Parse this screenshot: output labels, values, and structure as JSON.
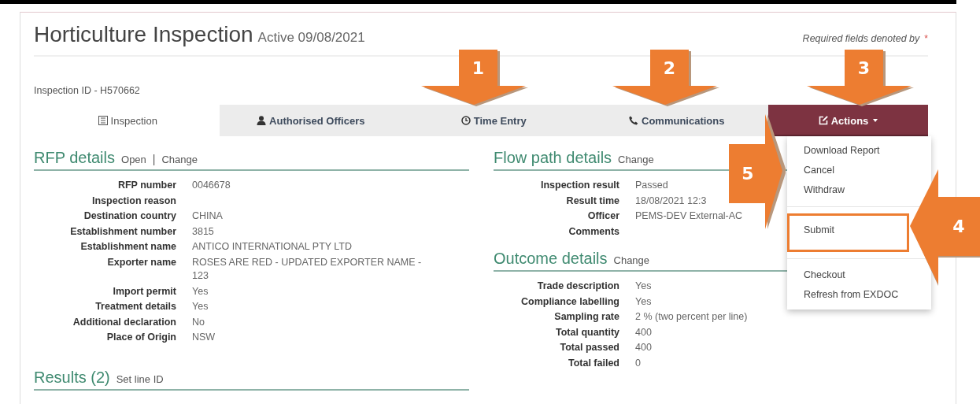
{
  "header": {
    "title": "Horticulture Inspection",
    "status": "Active 09/08/2021",
    "required_note": "Required fields denoted by",
    "required_mark": "*"
  },
  "inspection_id": "Inspection ID - H570662",
  "tabs": [
    {
      "label": "Inspection",
      "selected": true,
      "kind": "tab"
    },
    {
      "label": "Authorised Officers",
      "selected": false,
      "kind": "tab"
    },
    {
      "label": "Time Entry",
      "selected": false,
      "kind": "tab"
    },
    {
      "label": "Communications",
      "selected": false,
      "kind": "tab"
    },
    {
      "label": "Actions",
      "selected": false,
      "kind": "dropdown",
      "expanded": true
    }
  ],
  "rfp_details": {
    "title": "RFP details",
    "links": [
      "Open",
      "Change"
    ],
    "separator": "|",
    "rows": [
      {
        "label": "RFP number",
        "value": "0046678"
      },
      {
        "label": "Inspection reason",
        "value": ""
      },
      {
        "label": "Destination country",
        "value": "CHINA"
      },
      {
        "label": "Establishment number",
        "value": "3815"
      },
      {
        "label": "Establishment name",
        "value": "ANTICO INTERNATIONAL PTY LTD"
      },
      {
        "label": "Exporter name",
        "value": "ROSES ARE RED - UPDATED EXPORTER NAME - 123"
      },
      {
        "label": "Import permit",
        "value": "Yes"
      },
      {
        "label": "Treatment details",
        "value": "Yes"
      },
      {
        "label": "Additional declaration",
        "value": "No"
      },
      {
        "label": "Place of Origin",
        "value": "NSW"
      }
    ]
  },
  "flow_path_details": {
    "title": "Flow path details",
    "links": [
      "Change"
    ],
    "rows": [
      {
        "label": "Inspection result",
        "value": "Passed"
      },
      {
        "label": "Result time",
        "value": "18/08/2021 12:3"
      },
      {
        "label": "Officer",
        "value": "PEMS-DEV External-AC"
      },
      {
        "label": "Comments",
        "value": ""
      }
    ]
  },
  "outcome_details": {
    "title": "Outcome details",
    "links": [
      "Change"
    ],
    "rows": [
      {
        "label": "Trade description",
        "value": "Yes"
      },
      {
        "label": "Compliance labelling",
        "value": "Yes"
      },
      {
        "label": "Sampling rate",
        "value": "2 % (two percent per line)"
      },
      {
        "label": "Total quantity",
        "value": "400"
      },
      {
        "label": "Total passed",
        "value": "400"
      },
      {
        "label": "Total failed",
        "value": "0"
      }
    ]
  },
  "results": {
    "title": "Results (2)",
    "links": [
      "Set line ID"
    ]
  },
  "actions_menu": {
    "groups": [
      [
        {
          "label": "Download Report",
          "outlined": false
        },
        {
          "label": "Cancel",
          "outlined": false
        },
        {
          "label": "Withdraw",
          "outlined": false
        }
      ],
      [
        {
          "label": "Submit",
          "outlined": true
        }
      ],
      [
        {
          "label": "Checkout",
          "outlined": false
        },
        {
          "label": "Refresh from EXDOC",
          "outlined": false
        }
      ]
    ]
  },
  "callouts": [
    {
      "number": "1",
      "kind": "down"
    },
    {
      "number": "2",
      "kind": "down"
    },
    {
      "number": "3",
      "kind": "down"
    },
    {
      "number": "4",
      "kind": "left"
    },
    {
      "number": "5",
      "kind": "right"
    }
  ]
}
